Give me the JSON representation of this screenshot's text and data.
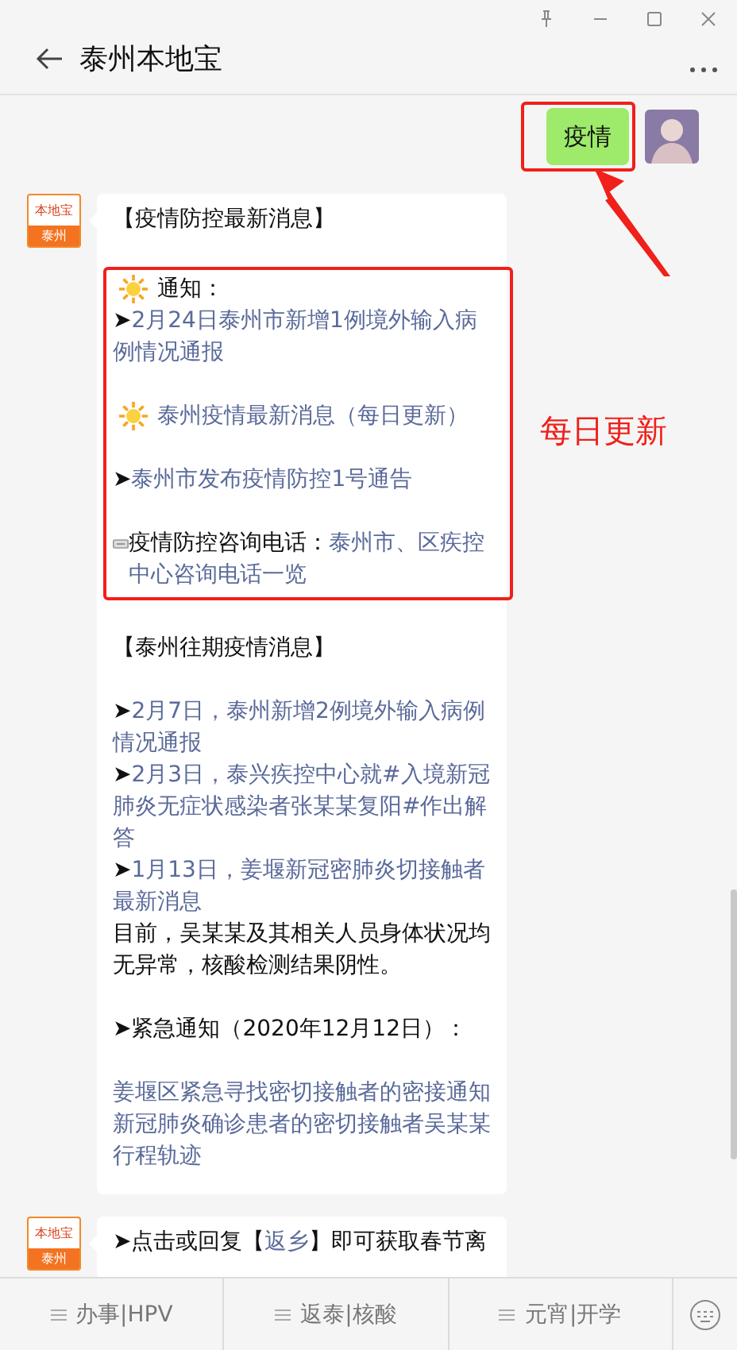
{
  "window": {
    "title": "泰州本地宝"
  },
  "messages": [
    {
      "kind": "user_text",
      "text": "疫情",
      "highlighted": true
    },
    {
      "kind": "account_article",
      "avatar": {
        "logo": "本地宝",
        "city": "泰州"
      },
      "sections": [
        {
          "boxed": false,
          "blocks": [
            [
              {
                "kind": "text",
                "parts": [
                  {
                    "kind": "text",
                    "text": "【疫情防控最新消息】"
                  }
                ]
              }
            ]
          ]
        },
        {
          "boxed": true,
          "blocks": [
            [
              {
                "kind": "sun",
                "parts": [
                  {
                    "kind": "text",
                    "text": "通知："
                  }
                ]
              },
              {
                "kind": "link",
                "parts": [
                  {
                    "kind": "text",
                    "text": "➤"
                  },
                  {
                    "kind": "link",
                    "text": "2月24日泰州市新增1例境外输入病例情况通报"
                  }
                ]
              }
            ],
            [
              {
                "kind": "sun",
                "parts": [
                  {
                    "kind": "link",
                    "text": "泰州疫情最新消息（每日更新）"
                  }
                ]
              }
            ],
            [
              {
                "kind": "link",
                "parts": [
                  {
                    "kind": "text",
                    "text": "➤"
                  },
                  {
                    "kind": "link",
                    "text": "泰州市发布疫情防控1号通告"
                  }
                ]
              }
            ],
            [
              {
                "kind": "phone",
                "parts": [
                  {
                    "kind": "text",
                    "text": "疫情防控咨询电话："
                  },
                  {
                    "kind": "link",
                    "text": "泰州市、区疾控中心咨询电话一览"
                  }
                ]
              }
            ]
          ]
        },
        {
          "boxed": false,
          "blocks": [
            [
              {
                "kind": "text",
                "parts": [
                  {
                    "kind": "text",
                    "text": "【泰州往期疫情消息】"
                  }
                ]
              }
            ],
            [
              {
                "kind": "link",
                "parts": [
                  {
                    "kind": "text",
                    "text": "➤"
                  },
                  {
                    "kind": "link",
                    "text": "2月7日，泰州新增2例境外输入病例情况通报"
                  }
                ]
              },
              {
                "kind": "link",
                "parts": [
                  {
                    "kind": "text",
                    "text": "➤"
                  },
                  {
                    "kind": "link",
                    "text": "2月3日，泰兴疾控中心就#入境新冠肺炎无症状感染者张某某复阳#作出解答"
                  }
                ]
              },
              {
                "kind": "link",
                "parts": [
                  {
                    "kind": "text",
                    "text": "➤"
                  },
                  {
                    "kind": "link",
                    "text": "1月13日，姜堰新冠密肺炎切接触者最新消息"
                  }
                ]
              },
              {
                "kind": "text",
                "parts": [
                  {
                    "kind": "text",
                    "text": "目前，吴某某及其相关人员身体状况均无异常，核酸检测结果阴性。"
                  }
                ]
              }
            ],
            [
              {
                "kind": "text",
                "parts": [
                  {
                    "kind": "text",
                    "text": "➤紧急通知（2020年12月12日）："
                  }
                ]
              }
            ],
            [
              {
                "kind": "link",
                "parts": [
                  {
                    "kind": "link",
                    "text": "姜堰区紧急寻找密切接触者的密接通知新冠肺炎确诊患者的密切接触者吴某某行程轨迹"
                  }
                ]
              }
            ]
          ]
        }
      ]
    },
    {
      "kind": "account_article",
      "avatar": {
        "logo": "本地宝",
        "city": "泰州"
      },
      "sections": [
        {
          "boxed": false,
          "blocks": [
            [
              {
                "kind": "text",
                "parts": [
                  {
                    "kind": "text",
                    "text": "➤点击或回复【"
                  },
                  {
                    "kind": "link",
                    "text": "返乡"
                  },
                  {
                    "kind": "text",
                    "text": "】即可获取春节离"
                  }
                ]
              }
            ]
          ]
        }
      ]
    }
  ],
  "annotation": {
    "label": "每日更新"
  },
  "menu": [
    {
      "label": "办事|HPV"
    },
    {
      "label": "返泰|核酸"
    },
    {
      "label": "元宵|开学"
    }
  ]
}
